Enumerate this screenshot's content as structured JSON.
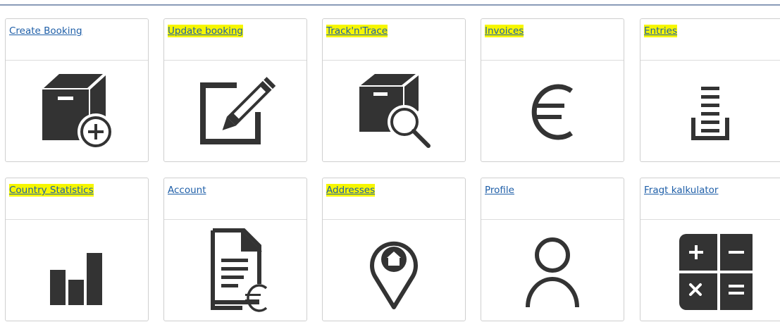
{
  "tiles": [
    {
      "label": "Create Booking",
      "highlighted": false,
      "icon": "box-add-icon"
    },
    {
      "label": "Update booking",
      "highlighted": true,
      "icon": "edit-icon"
    },
    {
      "label": "Track'n'Trace",
      "highlighted": true,
      "icon": "box-search-icon"
    },
    {
      "label": "Invoices",
      "highlighted": true,
      "icon": "euro-icon"
    },
    {
      "label": "Entries",
      "highlighted": true,
      "icon": "inbox-list-icon"
    },
    {
      "label": "Country Statistics",
      "highlighted": true,
      "icon": "bar-chart-icon"
    },
    {
      "label": "Account",
      "highlighted": false,
      "icon": "document-euro-icon"
    },
    {
      "label": "Addresses",
      "highlighted": true,
      "icon": "map-pin-home-icon"
    },
    {
      "label": "Profile",
      "highlighted": false,
      "icon": "user-icon"
    },
    {
      "label": "Fragt kalkulator",
      "highlighted": false,
      "icon": "calculator-icon"
    }
  ],
  "colors": {
    "link": "#1f5fa8",
    "highlight": "#f6f600",
    "icon": "#333333"
  }
}
